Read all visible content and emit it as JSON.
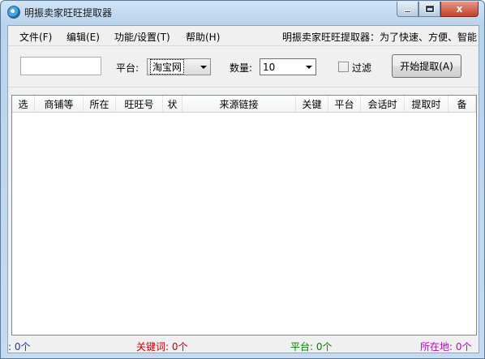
{
  "window": {
    "title": "明振卖家旺旺提取器",
    "minimize_label": "",
    "maximize_label": "",
    "close_label": "x"
  },
  "menu": {
    "items": [
      "文件(F)",
      "编辑(E)",
      "功能/设置(T)",
      "帮助(H)"
    ],
    "marquee": "明振卖家旺旺提取器：为了快速、方便、智能"
  },
  "toolbar": {
    "keyword_value": "",
    "platform_label": "平台:",
    "platform_value": "淘宝网",
    "count_label": "数量:",
    "count_value": "10",
    "filter_label": "过滤",
    "filter_checked": false,
    "start_button": "开始提取(A)"
  },
  "list": {
    "columns": [
      "选",
      "商铺等",
      "所在",
      "旺旺号",
      "状",
      "来源链接",
      "关键",
      "平台",
      "会话时",
      "提取时",
      "备"
    ],
    "rows": []
  },
  "status": {
    "total": ": 0个",
    "keyword": "关键词: 0个",
    "platform": "平台: 0个",
    "location": "所在地: 0个"
  },
  "colors": {
    "status_total": "#1a3fa0",
    "status_keyword": "#c00000",
    "status_platform": "#008000",
    "status_location": "#c000c0"
  }
}
